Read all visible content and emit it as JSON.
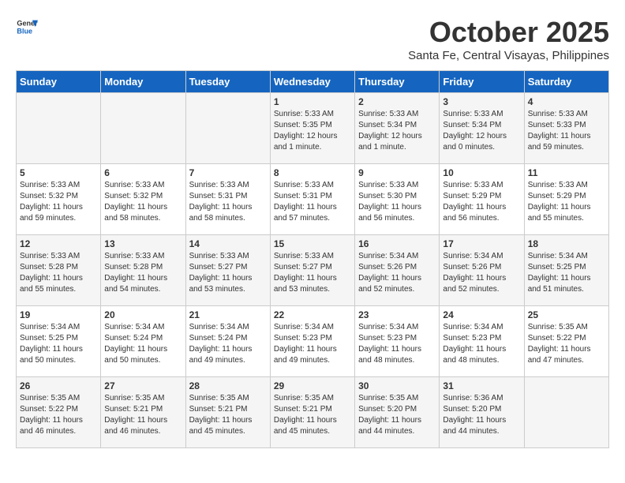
{
  "header": {
    "logo_general": "General",
    "logo_blue": "Blue",
    "month_title": "October 2025",
    "subtitle": "Santa Fe, Central Visayas, Philippines"
  },
  "weekdays": [
    "Sunday",
    "Monday",
    "Tuesday",
    "Wednesday",
    "Thursday",
    "Friday",
    "Saturday"
  ],
  "weeks": [
    [
      {
        "day": "",
        "info": ""
      },
      {
        "day": "",
        "info": ""
      },
      {
        "day": "",
        "info": ""
      },
      {
        "day": "1",
        "info": "Sunrise: 5:33 AM\nSunset: 5:35 PM\nDaylight: 12 hours\nand 1 minute."
      },
      {
        "day": "2",
        "info": "Sunrise: 5:33 AM\nSunset: 5:34 PM\nDaylight: 12 hours\nand 1 minute."
      },
      {
        "day": "3",
        "info": "Sunrise: 5:33 AM\nSunset: 5:34 PM\nDaylight: 12 hours\nand 0 minutes."
      },
      {
        "day": "4",
        "info": "Sunrise: 5:33 AM\nSunset: 5:33 PM\nDaylight: 11 hours\nand 59 minutes."
      }
    ],
    [
      {
        "day": "5",
        "info": "Sunrise: 5:33 AM\nSunset: 5:32 PM\nDaylight: 11 hours\nand 59 minutes."
      },
      {
        "day": "6",
        "info": "Sunrise: 5:33 AM\nSunset: 5:32 PM\nDaylight: 11 hours\nand 58 minutes."
      },
      {
        "day": "7",
        "info": "Sunrise: 5:33 AM\nSunset: 5:31 PM\nDaylight: 11 hours\nand 58 minutes."
      },
      {
        "day": "8",
        "info": "Sunrise: 5:33 AM\nSunset: 5:31 PM\nDaylight: 11 hours\nand 57 minutes."
      },
      {
        "day": "9",
        "info": "Sunrise: 5:33 AM\nSunset: 5:30 PM\nDaylight: 11 hours\nand 56 minutes."
      },
      {
        "day": "10",
        "info": "Sunrise: 5:33 AM\nSunset: 5:29 PM\nDaylight: 11 hours\nand 56 minutes."
      },
      {
        "day": "11",
        "info": "Sunrise: 5:33 AM\nSunset: 5:29 PM\nDaylight: 11 hours\nand 55 minutes."
      }
    ],
    [
      {
        "day": "12",
        "info": "Sunrise: 5:33 AM\nSunset: 5:28 PM\nDaylight: 11 hours\nand 55 minutes."
      },
      {
        "day": "13",
        "info": "Sunrise: 5:33 AM\nSunset: 5:28 PM\nDaylight: 11 hours\nand 54 minutes."
      },
      {
        "day": "14",
        "info": "Sunrise: 5:33 AM\nSunset: 5:27 PM\nDaylight: 11 hours\nand 53 minutes."
      },
      {
        "day": "15",
        "info": "Sunrise: 5:33 AM\nSunset: 5:27 PM\nDaylight: 11 hours\nand 53 minutes."
      },
      {
        "day": "16",
        "info": "Sunrise: 5:34 AM\nSunset: 5:26 PM\nDaylight: 11 hours\nand 52 minutes."
      },
      {
        "day": "17",
        "info": "Sunrise: 5:34 AM\nSunset: 5:26 PM\nDaylight: 11 hours\nand 52 minutes."
      },
      {
        "day": "18",
        "info": "Sunrise: 5:34 AM\nSunset: 5:25 PM\nDaylight: 11 hours\nand 51 minutes."
      }
    ],
    [
      {
        "day": "19",
        "info": "Sunrise: 5:34 AM\nSunset: 5:25 PM\nDaylight: 11 hours\nand 50 minutes."
      },
      {
        "day": "20",
        "info": "Sunrise: 5:34 AM\nSunset: 5:24 PM\nDaylight: 11 hours\nand 50 minutes."
      },
      {
        "day": "21",
        "info": "Sunrise: 5:34 AM\nSunset: 5:24 PM\nDaylight: 11 hours\nand 49 minutes."
      },
      {
        "day": "22",
        "info": "Sunrise: 5:34 AM\nSunset: 5:23 PM\nDaylight: 11 hours\nand 49 minutes."
      },
      {
        "day": "23",
        "info": "Sunrise: 5:34 AM\nSunset: 5:23 PM\nDaylight: 11 hours\nand 48 minutes."
      },
      {
        "day": "24",
        "info": "Sunrise: 5:34 AM\nSunset: 5:23 PM\nDaylight: 11 hours\nand 48 minutes."
      },
      {
        "day": "25",
        "info": "Sunrise: 5:35 AM\nSunset: 5:22 PM\nDaylight: 11 hours\nand 47 minutes."
      }
    ],
    [
      {
        "day": "26",
        "info": "Sunrise: 5:35 AM\nSunset: 5:22 PM\nDaylight: 11 hours\nand 46 minutes."
      },
      {
        "day": "27",
        "info": "Sunrise: 5:35 AM\nSunset: 5:21 PM\nDaylight: 11 hours\nand 46 minutes."
      },
      {
        "day": "28",
        "info": "Sunrise: 5:35 AM\nSunset: 5:21 PM\nDaylight: 11 hours\nand 45 minutes."
      },
      {
        "day": "29",
        "info": "Sunrise: 5:35 AM\nSunset: 5:21 PM\nDaylight: 11 hours\nand 45 minutes."
      },
      {
        "day": "30",
        "info": "Sunrise: 5:35 AM\nSunset: 5:20 PM\nDaylight: 11 hours\nand 44 minutes."
      },
      {
        "day": "31",
        "info": "Sunrise: 5:36 AM\nSunset: 5:20 PM\nDaylight: 11 hours\nand 44 minutes."
      },
      {
        "day": "",
        "info": ""
      }
    ]
  ]
}
